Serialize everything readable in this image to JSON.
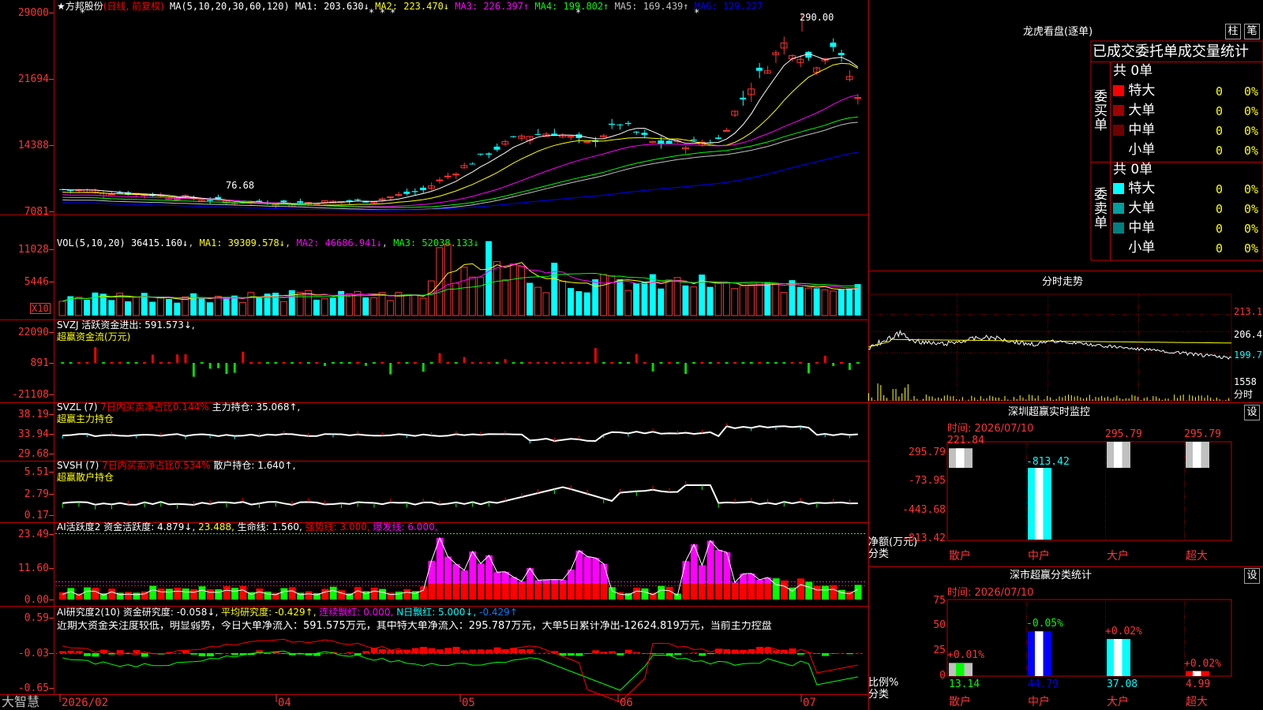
{
  "main": {
    "title": "★方邦股份",
    "mode": "(日线, 前复权)",
    "ma_label": "MA(5,10,20,30,60,120)",
    "ma": [
      {
        "name": "MA1",
        "value": "203.630↓",
        "color": "#ffffff"
      },
      {
        "name": "MA2",
        "value": "223.470↓",
        "color": "#ffff00"
      },
      {
        "name": "MA3",
        "value": "226.397↑",
        "color": "#ff00ff"
      },
      {
        "name": "MA4",
        "value": "199.802↑",
        "color": "#00ff00"
      },
      {
        "name": "MA5",
        "value": "169.439↑",
        "color": "#c0c0c0"
      },
      {
        "name": "MA6",
        "value": "129.227",
        "color": "#0000ff"
      }
    ],
    "axis": [
      "29000",
      "21694",
      "14388",
      "7081"
    ],
    "high_label": "290.00",
    "low_label": "76.68"
  },
  "vol": {
    "label": "VOL(5,10,20)",
    "value": "36415.160↓",
    "ma1": "MA1: 39309.578↓",
    "ma2": "MA2: 46686.941↓",
    "ma3": "MA3: 52038.133↓",
    "axis": [
      "11028",
      "5446"
    ],
    "unit": "X10"
  },
  "svzj": {
    "label": "SVZJ  活跃资金进出: 591.573↓,",
    "sub": "超赢资金流(万元)",
    "axis": [
      "22090",
      "891",
      "-21108"
    ]
  },
  "svzl": {
    "label": "SVZL  (7)",
    "p1": "7日内买卖净占比0.144%",
    "p2": "主力持仓: 35.068↑,",
    "sub": "超赢主力持仓",
    "axis": [
      "38.19",
      "33.94",
      "29.68"
    ]
  },
  "svsh": {
    "label": "SVSH  (7)",
    "p1": "7日内买卖净占比0.534%",
    "p2": "散户持仓: 1.640↑,",
    "sub": "超赢散户持仓",
    "axis": [
      "5.51",
      "2.79",
      "0.17"
    ]
  },
  "ai2": {
    "label": "AI活跃度2",
    "p1": "资金活跃度: 4.879↓,",
    "p2": "23.488,",
    "p3": "生命线: 1.560,",
    "p4": "强势线: 3.000,",
    "p5": "爆发线: 6.000,",
    "axis": [
      "23.49",
      "11.60",
      "0.00"
    ]
  },
  "ai_research": {
    "label": "AI研究度2(10)",
    "p1": "资金研究度: -0.058↓,",
    "p2": "平均研究度: -0.429↑,",
    "p3": "连续飘红: 0.000,",
    "p4": "N日飘红: 5.000↓,",
    "p5": "-0.429↑",
    "comment": "近期大资金关注度较低，明显弱势，今日大单净流入：591.575万元，其中特大单净流入：295.787万元，大单5日累计净出-12624.819万元，当前主力控盘",
    "axis": [
      "0.59",
      "-0.03",
      "-0.65"
    ]
  },
  "xaxis": {
    "brand": "大智慧",
    "labels": [
      "2026/02",
      "04",
      "05",
      "06",
      "07"
    ]
  },
  "lhb": {
    "title": "龙虎看盘(逐单)",
    "btn1": "柱",
    "btn2": "笔",
    "tabs": "已成交委托单成交量统计",
    "buy_group": "委买单",
    "sell_group": "委卖单",
    "buy_total": "共 0单",
    "sell_total": "共 0单",
    "buy_rows": [
      {
        "name": "特大",
        "count": "0",
        "pct": "0%",
        "color": "#ff0000"
      },
      {
        "name": "大单",
        "count": "0",
        "pct": "0%",
        "color": "#a00000"
      },
      {
        "name": "中单",
        "count": "0",
        "pct": "0%",
        "color": "#700000"
      },
      {
        "name": "小单",
        "count": "0",
        "pct": "0%",
        "color": "#000000"
      }
    ],
    "sell_rows": [
      {
        "name": "特大",
        "count": "0",
        "pct": "0%",
        "color": "#00ffff"
      },
      {
        "name": "大单",
        "count": "0",
        "pct": "0%",
        "color": "#00a0a0"
      },
      {
        "name": "中单",
        "count": "0",
        "pct": "0%",
        "color": "#008080"
      },
      {
        "name": "小单",
        "count": "0",
        "pct": "0%",
        "color": "#000000"
      }
    ]
  },
  "fenshi": {
    "title": "分时走势",
    "axis": [
      "213.1",
      "206.4",
      "199.7",
      "1558"
    ],
    "unit": "分时"
  },
  "monitor": {
    "title": "深圳超赢实时监控",
    "btn": "设",
    "time": "时间: 2026/07/10",
    "axis": [
      "295.79",
      "-73.95",
      "-443.68",
      "-813.42"
    ],
    "ylabel": "净额(万元)",
    "xlabel": "分类",
    "categories": [
      "散户",
      "中户",
      "大户",
      "超大"
    ],
    "values": [
      221.84,
      -813.42,
      295.79,
      295.79
    ],
    "value_labels": [
      "221.84",
      "-813.42",
      "295.79",
      "295.79"
    ]
  },
  "classify": {
    "title": "深市超赢分类统计",
    "btn": "设",
    "time": "时间: 2026/07/10",
    "axis": [
      "75",
      "50",
      "25",
      "0"
    ],
    "ylabel": "比例%",
    "xlabel": "分类",
    "categories": [
      "散户",
      "中户",
      "大户",
      "超大"
    ],
    "values": [
      13.14,
      44.79,
      37.08,
      4.99
    ],
    "changes": [
      "+0.01%",
      "-0.05%",
      "+0.02%",
      "+0.02%"
    ]
  }
}
